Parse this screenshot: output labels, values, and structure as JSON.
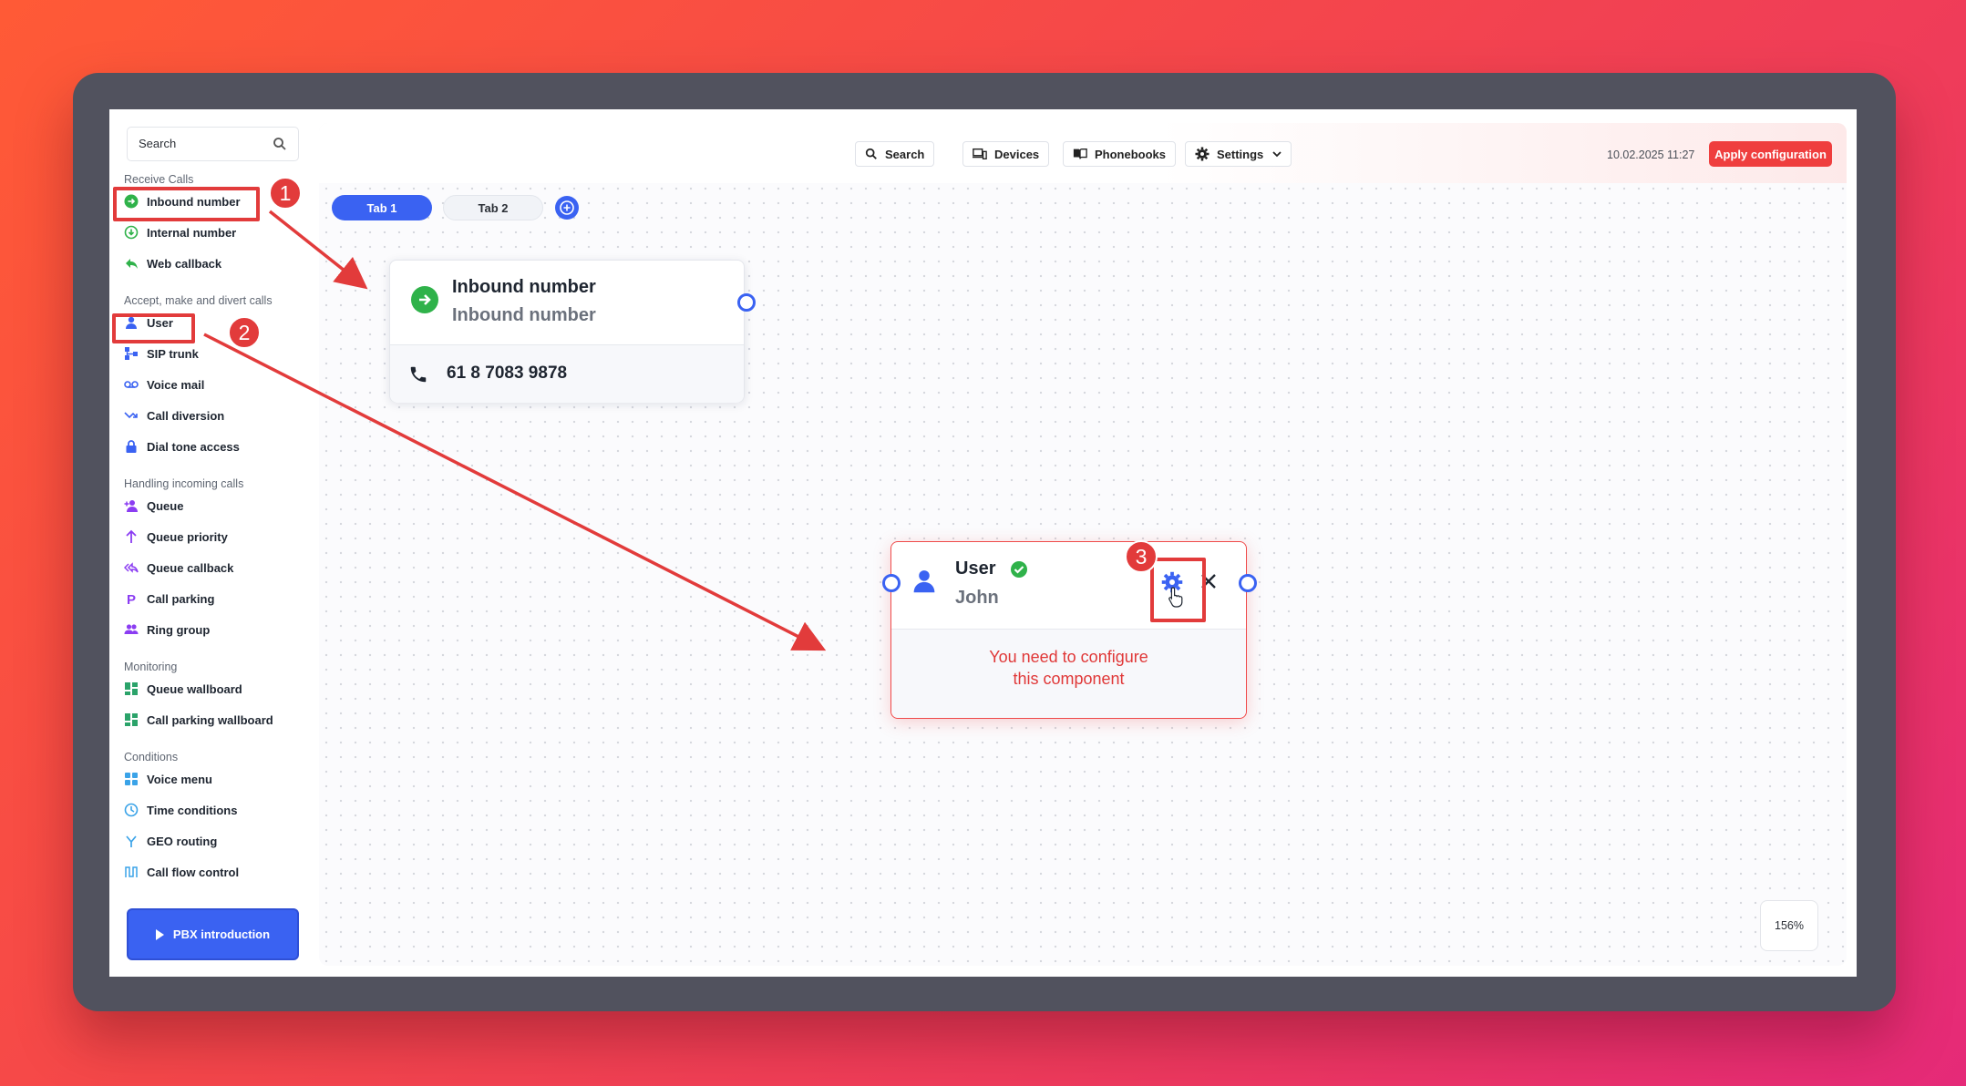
{
  "sidebar": {
    "search_placeholder": "Search",
    "sections": {
      "receive": "Receive Calls",
      "accept": "Accept, make and divert calls",
      "handling": "Handling incoming calls",
      "monitoring": "Monitoring",
      "conditions": "Conditions"
    },
    "items": {
      "inbound_number": "Inbound number",
      "internal_number": "Internal number",
      "web_callback": "Web callback",
      "user": "User",
      "sip_trunk": "SIP trunk",
      "voice_mail": "Voice mail",
      "call_diversion": "Call diversion",
      "dial_tone_access": "Dial tone access",
      "queue": "Queue",
      "queue_priority": "Queue priority",
      "queue_callback": "Queue callback",
      "call_parking": "Call parking",
      "ring_group": "Ring group",
      "queue_wallboard": "Queue wallboard",
      "call_parking_wallboard": "Call parking wallboard",
      "voice_menu": "Voice menu",
      "time_conditions": "Time conditions",
      "geo_routing": "GEO routing",
      "call_flow_control": "Call flow control"
    },
    "pbx_intro": "PBX introduction"
  },
  "toolbar": {
    "search": "Search",
    "devices": "Devices",
    "phonebooks": "Phonebooks",
    "settings": "Settings",
    "datetime": "10.02.2025 11:27",
    "apply": "Apply configuration"
  },
  "tabs": [
    "Tab 1",
    "Tab 2"
  ],
  "nodes": {
    "inbound": {
      "title": "Inbound number",
      "subtitle": "Inbound number",
      "phone": "61 8 7083 9878"
    },
    "user": {
      "title": "User",
      "subtitle": "John",
      "warning_line1": "You need to configure",
      "warning_line2": "this component"
    }
  },
  "zoom": "156%",
  "annotations": [
    "1",
    "2",
    "3"
  ],
  "colors": {
    "accent": "#3a62f2",
    "apply": "#ef3e3e",
    "annotation": "#e23b3b",
    "success": "#2fb24a"
  }
}
